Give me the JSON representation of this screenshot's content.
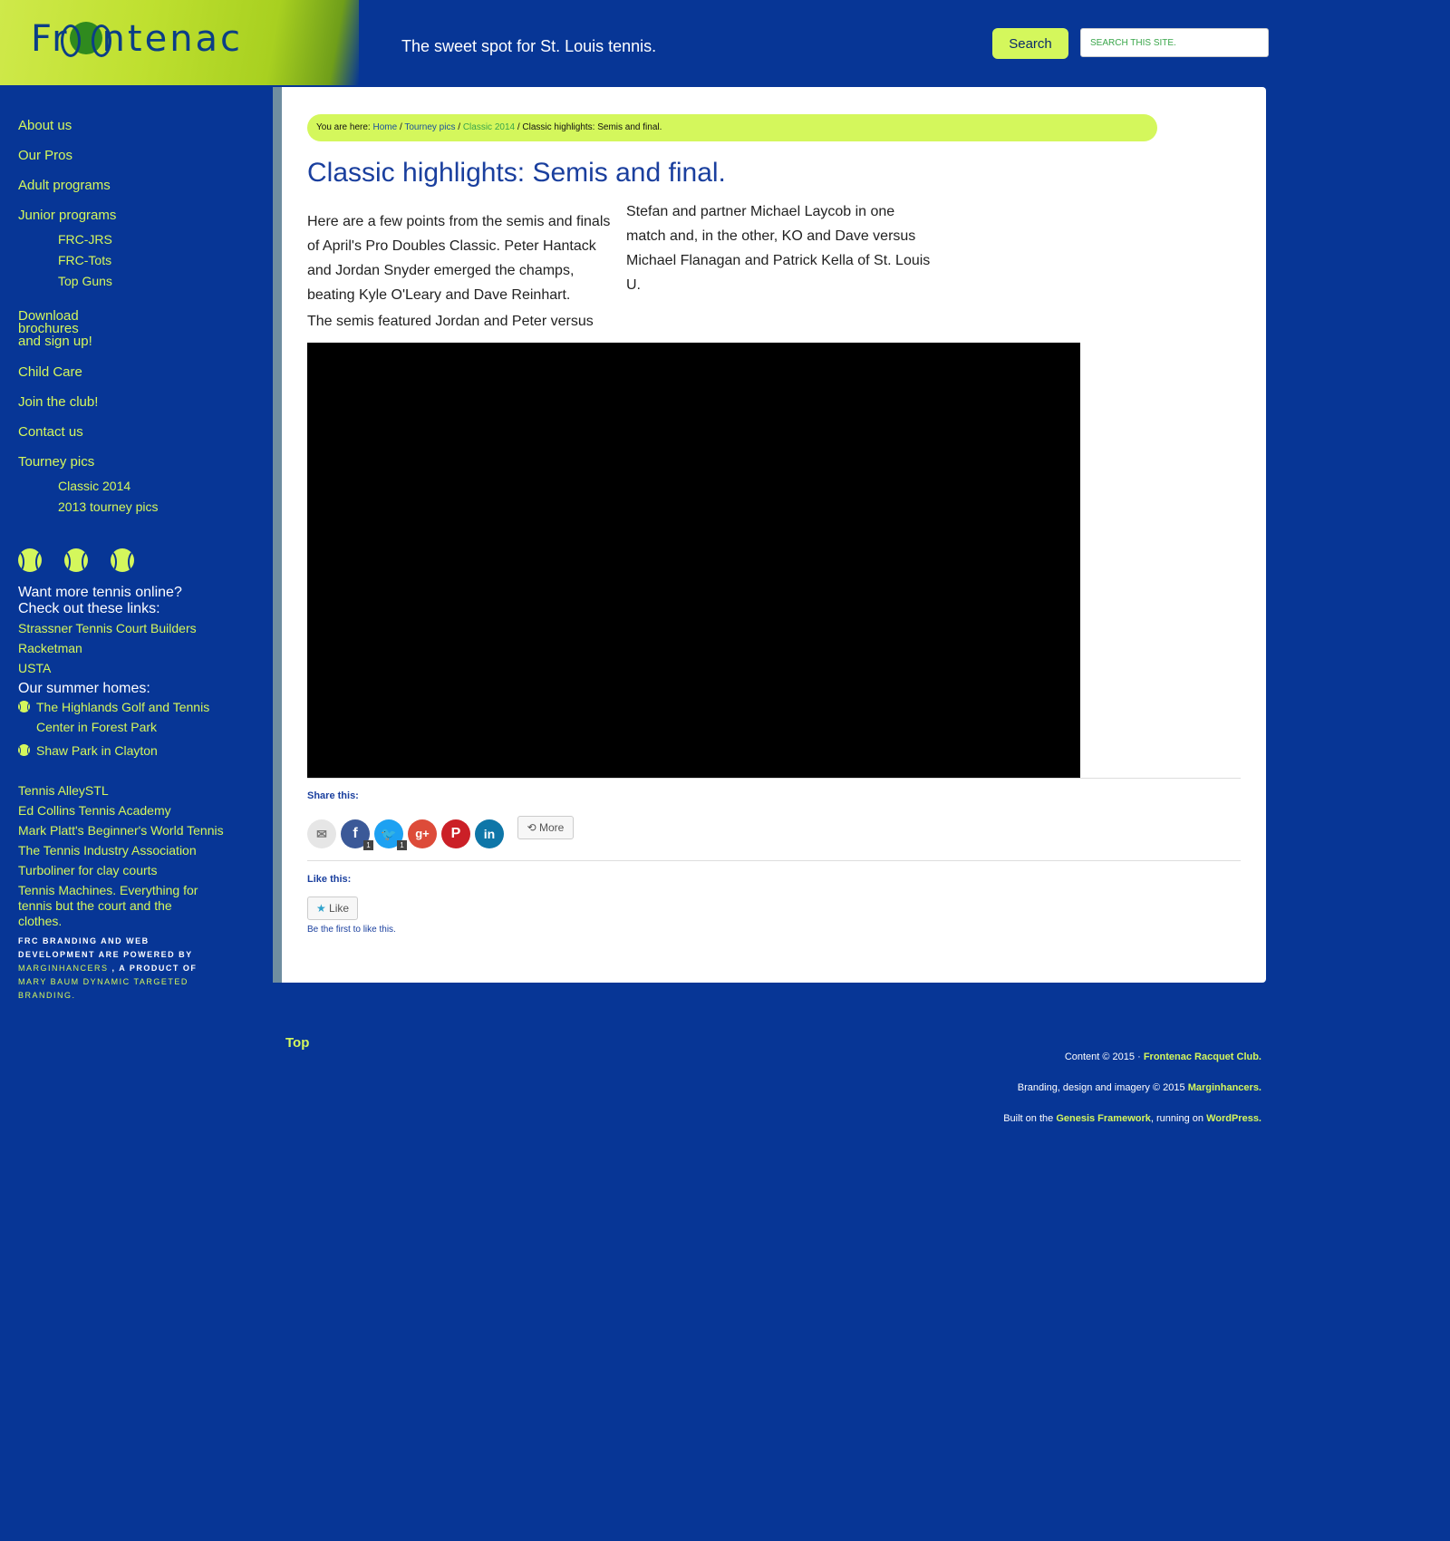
{
  "header": {
    "logo_text_left": "Fr",
    "logo_text_right": "ntenac",
    "tagline": "The sweet spot for St. Louis tennis.",
    "search_button": "Search",
    "search_placeholder": "SEARCH THIS SITE."
  },
  "sidebar": {
    "nav": {
      "about": "About us",
      "pros": "Our Pros",
      "adult": "Adult programs",
      "junior": "Junior programs",
      "frc_jrs": "FRC-JRS",
      "frc_tots": "FRC-Tots",
      "top_guns": "Top Guns",
      "download_1": "Download",
      "download_2": "brochures",
      "download_3": "and sign up!",
      "child_care": "Child Care",
      "join": "Join the club!",
      "contact": "Contact us",
      "tourney": "Tourney pics",
      "classic_2014": "Classic 2014",
      "tourney_2013": "2013 tourney pics"
    },
    "more_heading_1": "Want more tennis online?",
    "more_heading_2": "Check out these links:",
    "links_1": [
      "Strassner Tennis Court Builders",
      "Racketman",
      "USTA"
    ],
    "summer_heading": "Our summer homes:",
    "summer_1a": "The Highlands Golf and Tennis",
    "summer_1b": "Center in Forest Park",
    "summer_2": "Shaw Park in Clayton",
    "links_2": [
      "Tennis AlleySTL",
      "Ed Collins Tennis Academy",
      "Mark Platt's Beginner's World Tennis",
      "The Tennis Industry Association",
      "Turboliner for clay courts"
    ],
    "machines_1": "Tennis Machines. Everything for",
    "machines_2": "tennis but the court and the",
    "machines_3": "clothes.",
    "credit_1": "FRC branding and web development are powered by",
    "credit_link": "Marginhancers",
    "credit_2": ", a product of",
    "credit_3": "Mary Baum Dynamic Targeted Branding."
  },
  "breadcrumb": {
    "prefix": "You are here:",
    "home": "Home",
    "sep": "/",
    "tourney": "Tourney pics",
    "classic": "Classic 2014",
    "current": "Classic highlights: Semis and final."
  },
  "post": {
    "title": "Classic highlights: Semis and final.",
    "para1_lines": [
      "Here are a few points from the semis and finals",
      "of April's Pro Doubles Classic. Peter Hantack",
      "and Jordan Snyder emerged the champs,",
      "beating Kyle O'Leary and Dave Reinhart."
    ],
    "para2": "The semis featured Jordan and Peter versus",
    "para3_lines": [
      "Stefan and partner Michael Laycob in one",
      "match and, in the other, KO and Dave versus",
      "Michael Flanagan and Patrick Kella of St. Louis",
      "U."
    ]
  },
  "share": {
    "label": "Share this:",
    "facebook_count": "1",
    "twitter_count": "1",
    "more": "More",
    "like_label": "Like this:",
    "like_button": "Like",
    "like_note": "Be the first to like this."
  },
  "footer": {
    "top": "Top",
    "content_prefix": "Content © 2015 ·",
    "content_link": "Frontenac Racquet Club.",
    "branding_prefix": "Branding, design and imagery © 2015",
    "branding_link": "Marginhancers.",
    "built_prefix": "Built on the",
    "built_link1": "Genesis Framework",
    "built_mid": ", running on",
    "built_link2": "WordPress."
  },
  "colors": {
    "background": "#073696",
    "accent": "#d4f75c",
    "title": "#1a3f9e"
  }
}
